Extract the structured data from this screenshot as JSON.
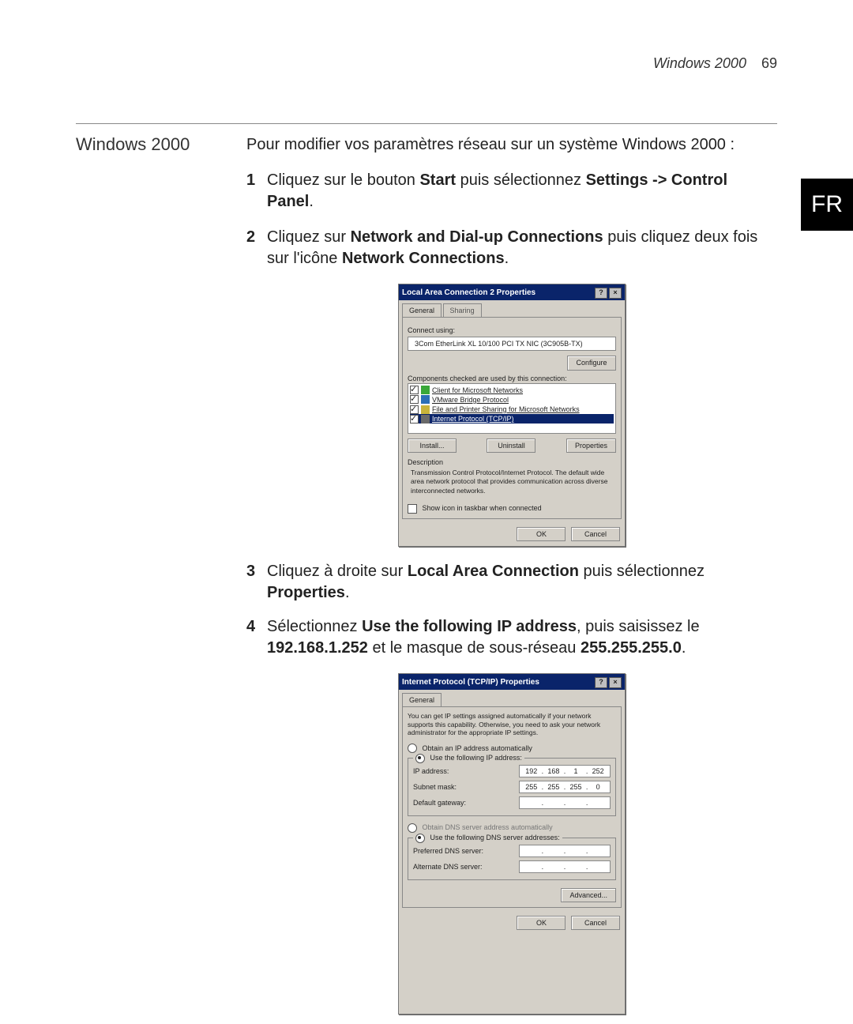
{
  "header": {
    "title": "Windows 2000",
    "page": "69"
  },
  "frTab": "FR",
  "sectionTitle": "Windows 2000",
  "intro": "Pour modifier vos paramètres réseau sur un système Windows 2000 :",
  "steps": {
    "s1": {
      "num": "1",
      "pre": "Cliquez sur le bouton ",
      "b1": "Start",
      "mid": " puis sélectionnez ",
      "b2": "Settings -> Control Panel",
      "post": "."
    },
    "s2": {
      "num": "2",
      "pre": "Cliquez sur ",
      "b1": "Network and Dial-up Connections",
      "mid": " puis cliquez deux fois sur l'icône ",
      "b2": "Network Connections",
      "post": "."
    },
    "s3": {
      "num": "3",
      "pre": "Cliquez à droite sur ",
      "b1": "Local Area Connection",
      "mid": " puis sélectionnez ",
      "b2": "Properties",
      "post": "."
    },
    "s4": {
      "num": "4",
      "pre": "Sélectionnez ",
      "b1": "Use the following IP address",
      "mid": ", puis saisissez le ",
      "b2": "192.168.1.252",
      "mid2": " et le masque de sous-réseau ",
      "b3": "255.255.255.0",
      "post": "."
    }
  },
  "dlg1": {
    "title": "Local Area Connection 2 Properties",
    "help": "?",
    "close": "×",
    "tabs": {
      "general": "General",
      "sharing": "Sharing"
    },
    "connectUsing": "Connect using:",
    "adapter": "3Com EtherLink XL 10/100 PCI TX NIC (3C905B-TX)",
    "configure": "Configure",
    "componentsLabel": "Components checked are used by this connection:",
    "items": [
      {
        "checked": true,
        "iconClass": "g",
        "text": "Client for Microsoft Networks"
      },
      {
        "checked": true,
        "iconClass": "b",
        "text": "VMware Bridge Protocol"
      },
      {
        "checked": true,
        "iconClass": "y",
        "text": "File and Printer Sharing for Microsoft Networks"
      },
      {
        "checked": true,
        "iconClass": "k",
        "text": "Internet Protocol (TCP/IP)",
        "selected": true
      }
    ],
    "install": "Install...",
    "uninstall": "Uninstall",
    "properties": "Properties",
    "descLabel": "Description",
    "desc": "Transmission Control Protocol/Internet Protocol. The default wide area network protocol that provides communication across diverse interconnected networks.",
    "showIcon": "Show icon in taskbar when connected",
    "ok": "OK",
    "cancel": "Cancel"
  },
  "dlg2": {
    "title": "Internet Protocol (TCP/IP) Properties",
    "help": "?",
    "close": "×",
    "tabGeneral": "General",
    "blurb": "You can get IP settings assigned automatically if your network supports this capability. Otherwise, you need to ask your network administrator for the appropriate IP settings.",
    "obtainAuto": "Obtain an IP address automatically",
    "useFollowing": "Use the following IP address:",
    "ipLabel": "IP address:",
    "ip": [
      "192",
      "168",
      "1",
      "252"
    ],
    "subnetLabel": "Subnet mask:",
    "subnet": [
      "255",
      "255",
      "255",
      "0"
    ],
    "gatewayLabel": "Default gateway:",
    "gateway": [
      "",
      "",
      "",
      ""
    ],
    "obtainDnsAuto": "Obtain DNS server address automatically",
    "useDns": "Use the following DNS server addresses:",
    "prefDnsLabel": "Preferred DNS server:",
    "altDnsLabel": "Alternate DNS server:",
    "advanced": "Advanced...",
    "ok": "OK",
    "cancel": "Cancel"
  }
}
